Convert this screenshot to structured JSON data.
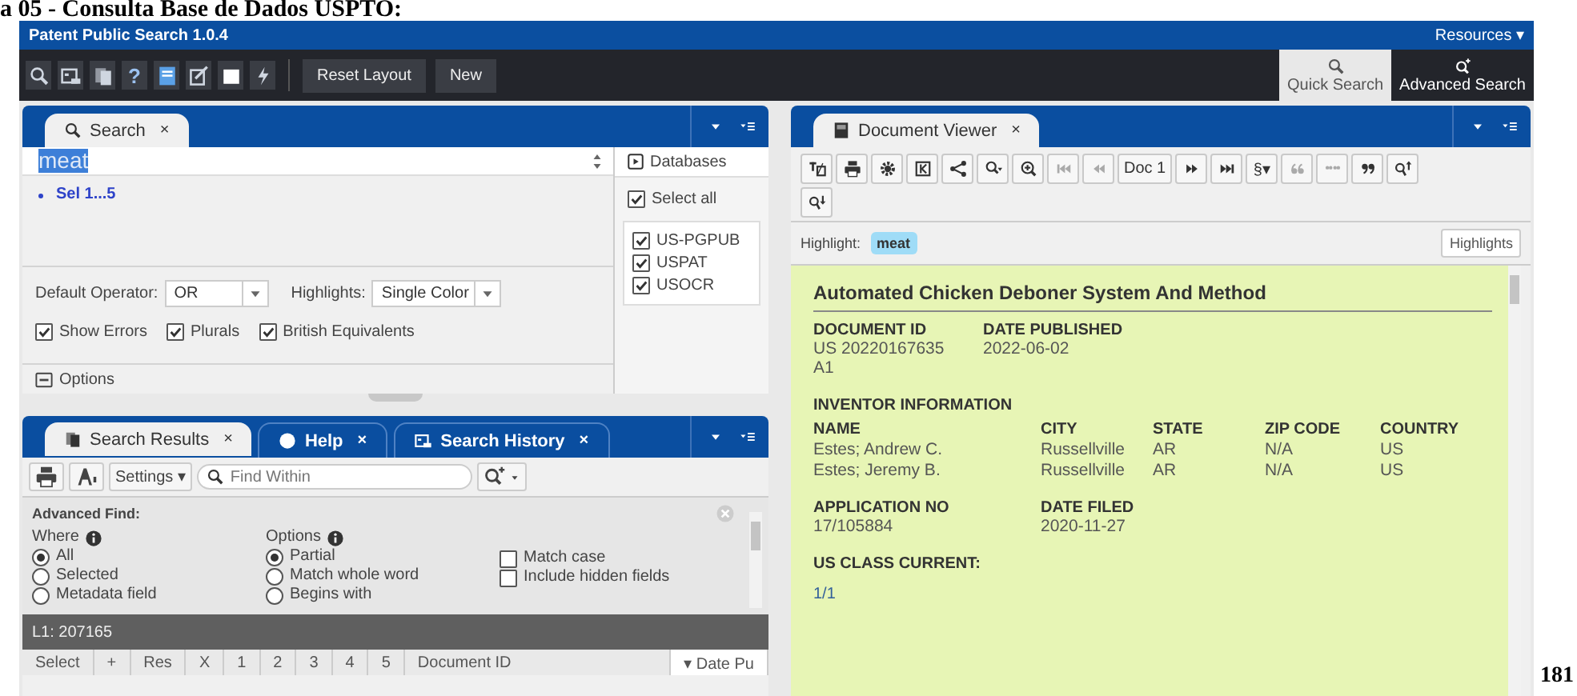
{
  "slide_title": "a 05 - Consulta Base de Dados USPTO:",
  "page_number": "181",
  "app": {
    "title": "Patent Public Search 1.0.4",
    "resources": "Resources ▾"
  },
  "toolbar": {
    "tools": [
      {
        "kind": "icon"
      },
      {
        "kind": "icon"
      },
      {
        "kind": "icon"
      },
      {
        "kind": "glyph",
        "label": "?"
      },
      {
        "kind": "icon"
      },
      {
        "kind": "icon"
      },
      {
        "kind": "icon"
      },
      {
        "kind": "icon"
      }
    ],
    "buttons": [
      "Reset Layout",
      "New"
    ]
  },
  "search_modes": [
    {
      "label": "Quick Search",
      "selected": true
    },
    {
      "label": "Advanced Search",
      "selected": false
    }
  ],
  "search_panel": {
    "tab": "Search",
    "close": "×",
    "query": "meat",
    "sel": "Sel 1...5",
    "default_operator": {
      "label": "Default Operator:",
      "value": "OR"
    },
    "highlights": {
      "label": "Highlights:",
      "value": "Single Color"
    },
    "options": [
      {
        "label": "Show Errors",
        "checked": true
      },
      {
        "label": "Plurals",
        "checked": true
      },
      {
        "label": "British Equivalents",
        "checked": true
      }
    ],
    "options_toggle": "Options",
    "databases": {
      "title": "Databases",
      "select_all": {
        "label": "Select all",
        "checked": true
      },
      "items": [
        {
          "label": "US-PGPUB",
          "checked": true
        },
        {
          "label": "USPAT",
          "checked": true
        },
        {
          "label": "USOCR",
          "checked": true
        }
      ]
    }
  },
  "results_panel": {
    "tabs": [
      {
        "label": "Search Results",
        "close": "×",
        "selected": true
      },
      {
        "label": "Help",
        "close": "×",
        "selected": false
      },
      {
        "label": "Search History",
        "close": "×",
        "selected": false
      }
    ],
    "settings": "Settings ▾",
    "find_placeholder": "Find Within",
    "advanced_find": {
      "title": "Advanced Find:",
      "where": {
        "label": "Where",
        "options": [
          {
            "label": "All",
            "selected": true
          },
          {
            "label": "Selected",
            "selected": false
          },
          {
            "label": "Metadata field",
            "selected": false
          }
        ]
      },
      "options": {
        "label": "Options",
        "radios": [
          {
            "label": "Partial",
            "selected": true
          },
          {
            "label": "Match whole word",
            "selected": false
          },
          {
            "label": "Begins with",
            "selected": false
          }
        ],
        "checks": [
          {
            "label": "Match case",
            "checked": false
          },
          {
            "label": "Include hidden fields",
            "checked": false
          }
        ]
      }
    },
    "list_label": "L1: 207165",
    "columns": [
      "Select",
      "+",
      "Res",
      "X",
      "1",
      "2",
      "3",
      "4",
      "5",
      "Document ID",
      "▾ Date Pu"
    ]
  },
  "viewer": {
    "tab": "Document Viewer",
    "close": "×",
    "tools": [
      {
        "kind": "icon",
        "disabled": false
      },
      {
        "kind": "icon",
        "disabled": false
      },
      {
        "kind": "icon",
        "disabled": false
      },
      {
        "kind": "icon",
        "disabled": false
      },
      {
        "kind": "icon",
        "disabled": false
      },
      {
        "kind": "icon",
        "disabled": false
      },
      {
        "kind": "icon",
        "disabled": false
      },
      {
        "kind": "icon",
        "disabled": true
      },
      {
        "kind": "icon",
        "disabled": true
      },
      {
        "kind": "text",
        "label": "Doc 1",
        "disabled": false
      },
      {
        "kind": "icon",
        "disabled": false
      },
      {
        "kind": "icon",
        "disabled": false
      },
      {
        "kind": "text",
        "label": "§▾",
        "disabled": false
      },
      {
        "kind": "icon",
        "disabled": true
      },
      {
        "kind": "icon",
        "disabled": true
      },
      {
        "kind": "icon",
        "disabled": false
      },
      {
        "kind": "icon",
        "disabled": false
      },
      {
        "kind": "icon",
        "disabled": false
      }
    ],
    "highlight_label": "Highlight:",
    "highlight_term": "meat",
    "highlights_button": "Highlights",
    "document": {
      "title": "Automated Chicken Deboner System And Method",
      "ids": [
        {
          "label": "DOCUMENT ID",
          "value": "US 20220167635 A1"
        },
        {
          "label": "DATE PUBLISHED",
          "value": "2022-06-02"
        }
      ],
      "inventor_heading": "INVENTOR INFORMATION",
      "inventor_columns": [
        "NAME",
        "CITY",
        "STATE",
        "ZIP CODE",
        "COUNTRY"
      ],
      "inventors": [
        [
          "Estes; Andrew C.",
          "Russellville",
          "AR",
          "N/A",
          "US"
        ],
        [
          "Estes; Jeremy B.",
          "Russellville",
          "AR",
          "N/A",
          "US"
        ]
      ],
      "application": [
        {
          "label": "APPLICATION NO",
          "value": "17/105884"
        },
        {
          "label": "DATE FILED",
          "value": "2020-11-27"
        }
      ],
      "class_heading": "US CLASS CURRENT:",
      "class_value": "1/1"
    }
  }
}
